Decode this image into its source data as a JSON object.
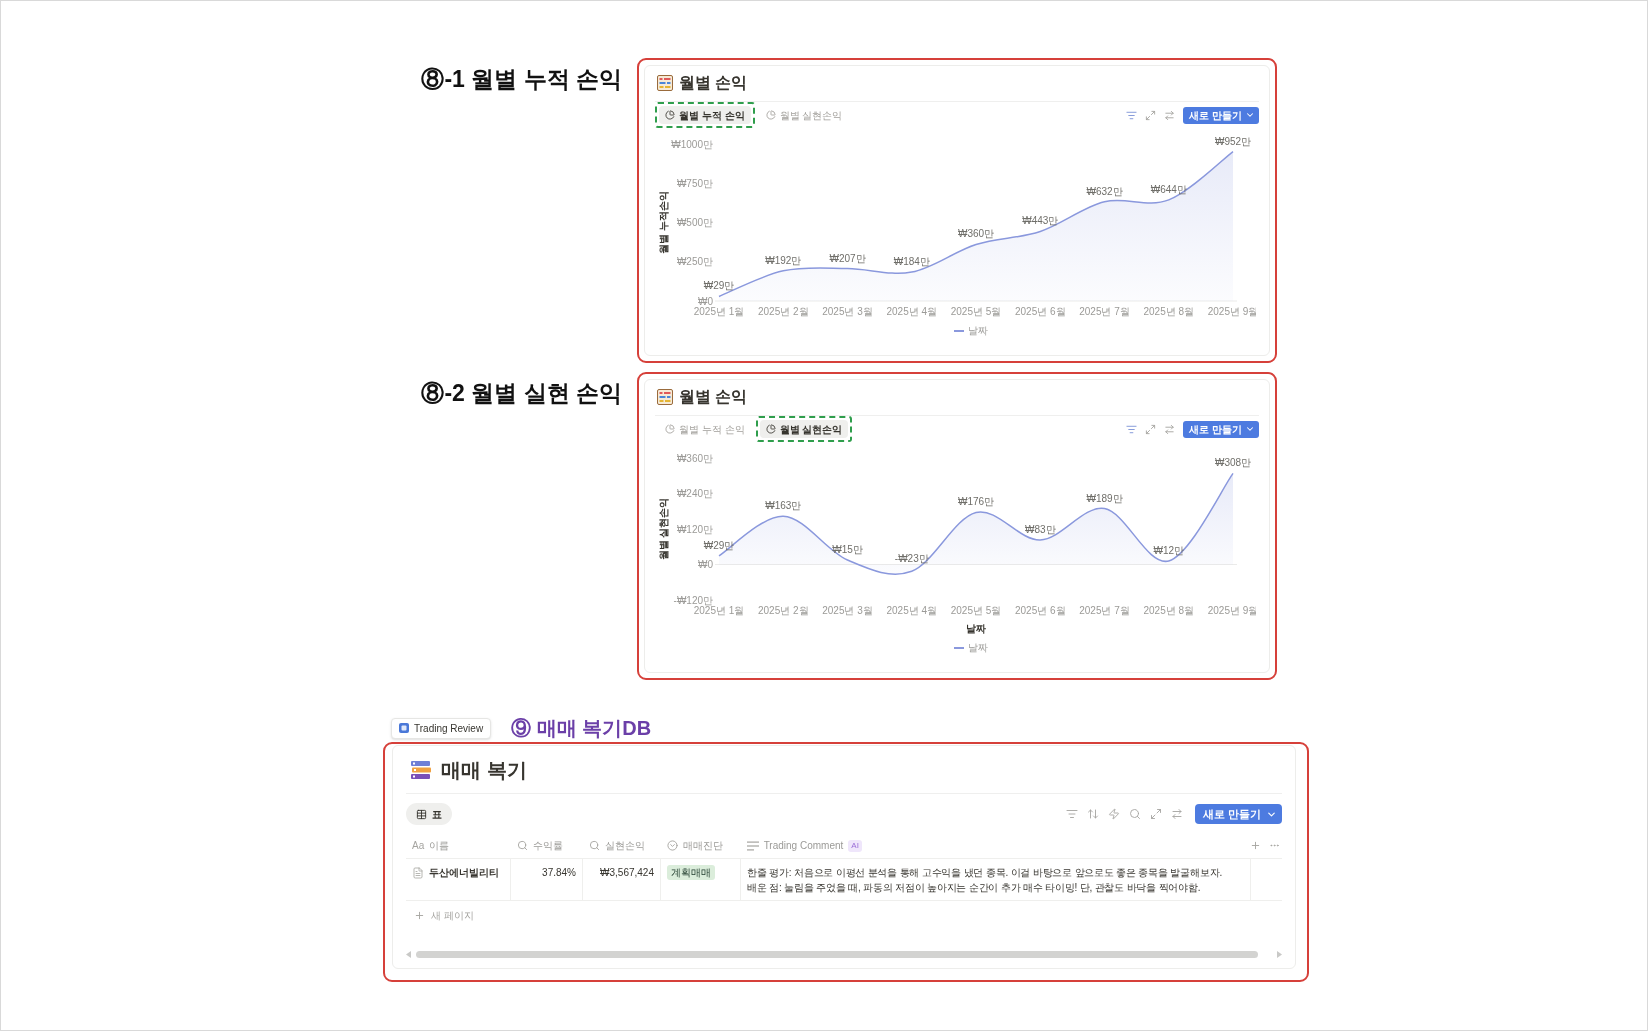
{
  "chart_sections": [
    {
      "caption": "⑧-1 월별 누적 손익",
      "title": "월별 손익",
      "tabs": [
        {
          "label": "월별 누적 손익",
          "selected": true
        },
        {
          "label": "월별 실현손익",
          "selected": false
        }
      ],
      "new_button": "새로 만들기",
      "chart_data": {
        "type": "area",
        "ylabel": "월별 누적손익",
        "categories": [
          "2025년 1월",
          "2025년 2월",
          "2025년 3월",
          "2025년 4월",
          "2025년 5월",
          "2025년 6월",
          "2025년 7월",
          "2025년 8월",
          "2025년 9월"
        ],
        "series": [
          {
            "name": "날짜",
            "color": "#8a98dd",
            "values": [
              29,
              192,
              207,
              184,
              360,
              443,
              632,
              644,
              952
            ]
          }
        ],
        "ylim": [
          0,
          1000
        ],
        "yticks": [
          {
            "value": 0,
            "label": "₩0"
          },
          {
            "value": 250,
            "label": "₩250만"
          },
          {
            "value": 500,
            "label": "₩500만"
          },
          {
            "value": 750,
            "label": "₩750만"
          },
          {
            "value": 1000,
            "label": "₩1000만"
          }
        ],
        "value_labels": [
          "₩29만",
          "₩192만",
          "₩207만",
          "₩184만",
          "₩360만",
          "₩443만",
          "₩632만",
          "₩644만",
          "₩952만"
        ]
      }
    },
    {
      "caption": "⑧-2 월별 실현 손익",
      "title": "월별 손익",
      "tabs": [
        {
          "label": "월별 누적 손익",
          "selected": false
        },
        {
          "label": "월별 실현손익",
          "selected": true
        }
      ],
      "new_button": "새로 만들기",
      "chart_data": {
        "type": "area",
        "xlabel": "날짜",
        "ylabel": "월별 실현손익",
        "categories": [
          "2025년 1월",
          "2025년 2월",
          "2025년 3월",
          "2025년 4월",
          "2025년 5월",
          "2025년 6월",
          "2025년 7월",
          "2025년 8월",
          "2025년 9월"
        ],
        "series": [
          {
            "name": "날짜",
            "color": "#8a98dd",
            "values": [
              29,
              163,
              15,
              -23,
              176,
              83,
              189,
              12,
              308
            ]
          }
        ],
        "ylim": [
          -120,
          360
        ],
        "yticks": [
          {
            "value": -120,
            "label": "-₩120만"
          },
          {
            "value": 0,
            "label": "₩0"
          },
          {
            "value": 120,
            "label": "₩120만"
          },
          {
            "value": 240,
            "label": "₩240만"
          },
          {
            "value": 360,
            "label": "₩360만"
          }
        ],
        "value_labels": [
          "₩29만",
          "₩163만",
          "₩15만",
          "-₩23만",
          "₩176만",
          "₩83만",
          "₩189만",
          "₩12만",
          "₩308만"
        ]
      }
    }
  ],
  "database": {
    "breadcrumb": "Trading Review",
    "caption": "⑨ 매매 복기DB",
    "title": "매매 복기",
    "views": [
      {
        "label": "표",
        "selected": true
      }
    ],
    "new_button": "새로 만들기",
    "columns": [
      {
        "kind": "title",
        "glyph": "Aa",
        "label": "이름"
      },
      {
        "kind": "formula",
        "label": "수익률"
      },
      {
        "kind": "formula",
        "label": "실현손익"
      },
      {
        "kind": "select",
        "label": "매매진단"
      },
      {
        "kind": "text",
        "label": "Trading Comment",
        "badge": "AI"
      }
    ],
    "rows": [
      {
        "cells": [
          {
            "text": "두산에너빌리티"
          },
          {
            "text": "37.84%"
          },
          {
            "text": "₩3,567,424"
          },
          {
            "tag": "계획매매"
          },
          {
            "lines": [
              "한줄 평가: 처음으로 이평선 분석을 통해 고수익을 냈던 종목. 이걸 바탕으로 앞으로도 좋은 종목을 발굴해보자.",
              "배운 점: 눌림을 주었을 때, 파동의 저점이 높아지는 순간이 추가 매수 타이밍! 단, 관찰도 바닥을 찍어야함."
            ]
          }
        ]
      }
    ],
    "add_row": "새 페이지"
  }
}
